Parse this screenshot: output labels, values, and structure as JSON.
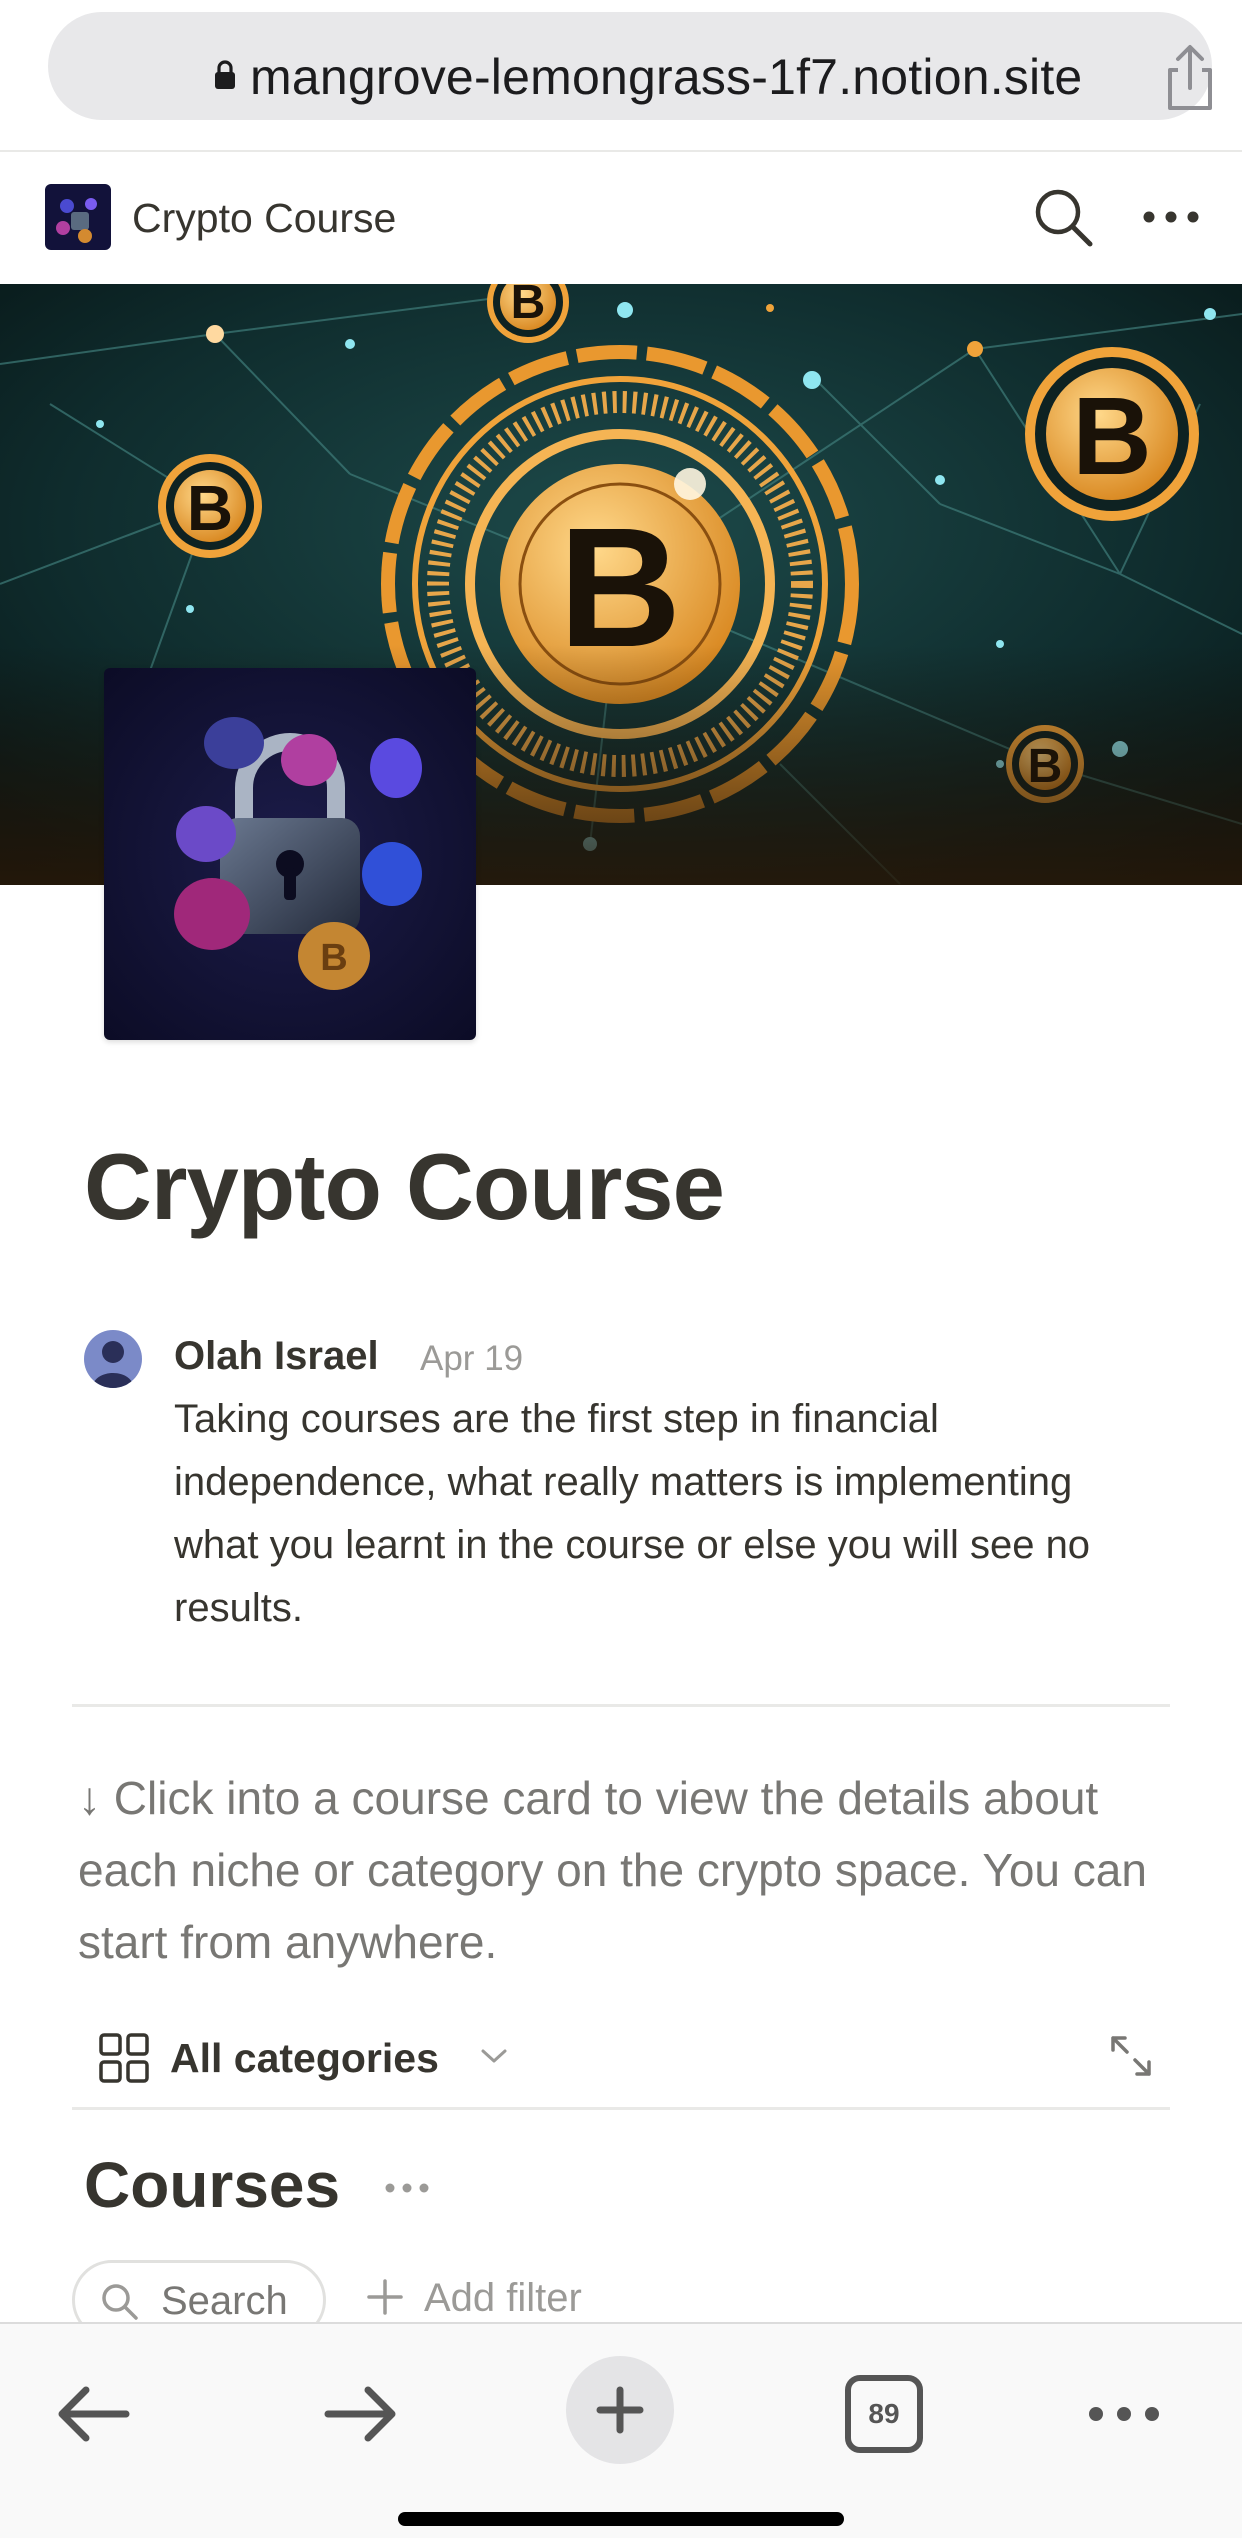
{
  "browser": {
    "url": "mangrove-lemongrass-1f7.notion.site",
    "tab_count": "89"
  },
  "topbar": {
    "title": "Crypto Course"
  },
  "page": {
    "title": "Crypto Course",
    "comment": {
      "author": "Olah Israel",
      "date": "Apr 19",
      "text": "Taking courses are the first step in financial independence, what really matters is implementing what you learnt in the course or else you will see no results."
    },
    "callout": "↓ Click into a course card to view the details about each niche or category on the crypto space. You can start from anywhere.",
    "view": {
      "label": "All categories"
    },
    "database": {
      "title": "Courses",
      "search_label": "Search",
      "add_filter_label": "Add filter"
    }
  },
  "colors": {
    "text": "#37352f",
    "muted": "#787774",
    "gold": "#f0a33a",
    "cover_bg": "#0f2a2a"
  }
}
